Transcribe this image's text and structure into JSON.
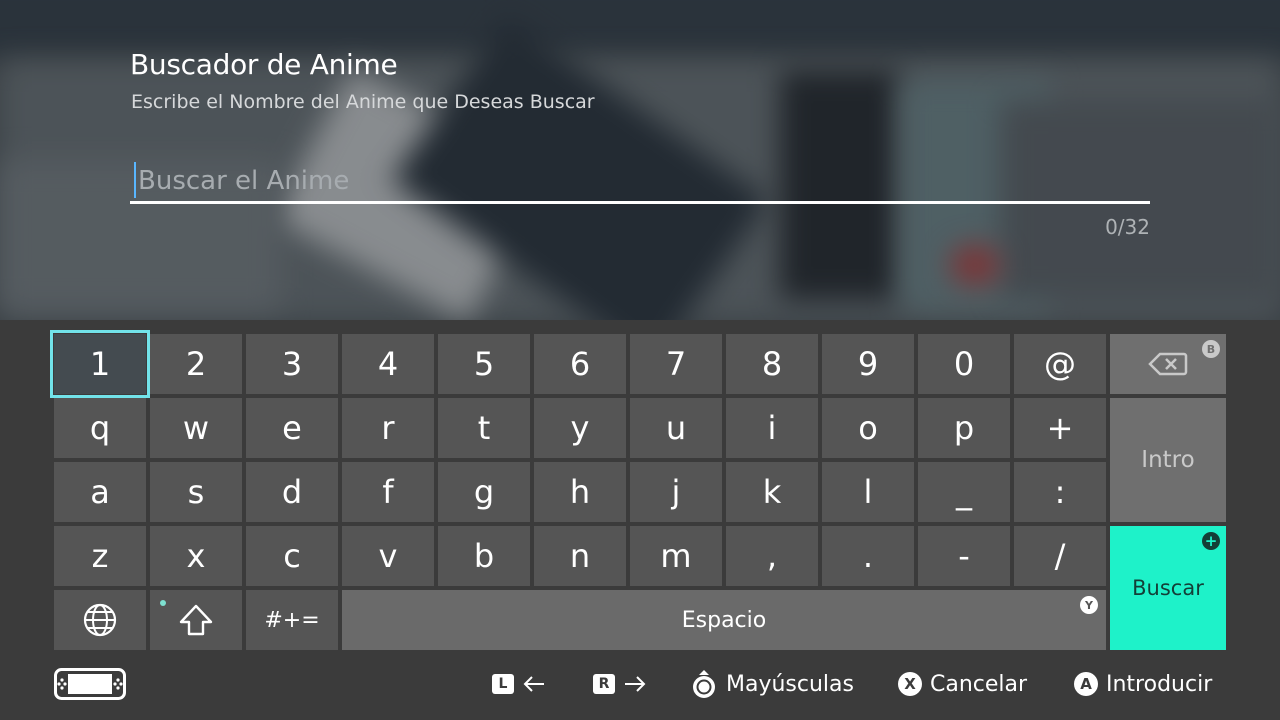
{
  "header": {
    "title": "Buscador de Anime",
    "subtitle": "Escribe el Nombre del Anime que Deseas Buscar"
  },
  "search": {
    "value": "",
    "placeholder": "Buscar el Anime",
    "counter": "0/32"
  },
  "keyboard": {
    "row1": [
      "1",
      "2",
      "3",
      "4",
      "5",
      "6",
      "7",
      "8",
      "9",
      "0",
      "@"
    ],
    "row2": [
      "q",
      "w",
      "e",
      "r",
      "t",
      "y",
      "u",
      "i",
      "o",
      "p",
      "+"
    ],
    "row3": [
      "a",
      "s",
      "d",
      "f",
      "g",
      "h",
      "j",
      "k",
      "l",
      "_",
      ":"
    ],
    "row4": [
      "z",
      "x",
      "c",
      "v",
      "b",
      "n",
      "m",
      ",",
      ".",
      "-",
      "/"
    ],
    "symbols_label": "#+=",
    "space_label": "Espacio",
    "enter_label": "Intro",
    "submit_label": "Buscar",
    "backspace_badge": "B",
    "space_badge": "Y",
    "submit_badge": "+",
    "selected_key": "1",
    "accent_color": "#1ef2c9",
    "selection_color": "#72e3ea"
  },
  "footer": {
    "l_button": "L",
    "r_button": "R",
    "shift_label": "Mayúsculas",
    "x_button": "X",
    "cancel_label": "Cancelar",
    "a_button": "A",
    "confirm_label": "Introducir"
  }
}
